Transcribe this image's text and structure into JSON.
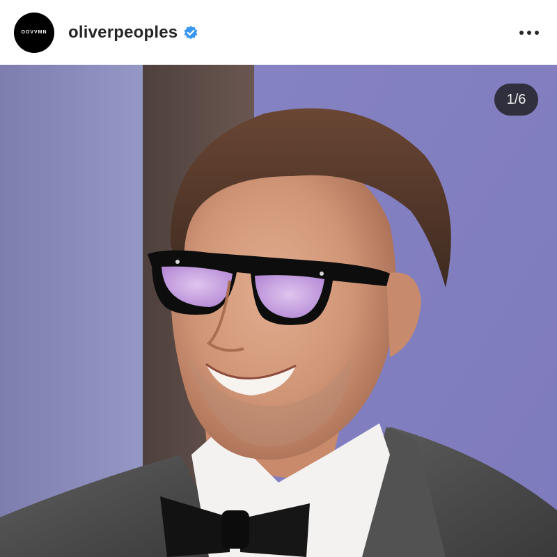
{
  "post": {
    "avatar_label": "OOVVMN",
    "username": "oliverpeoples",
    "verified": true,
    "counter": "1/6"
  },
  "icons": {
    "verified": "verified-badge-icon",
    "more": "more-horizontal-icon"
  },
  "colors": {
    "verified_blue": "#3897f0",
    "backdrop_lavender": "#8f8cc8",
    "lens_tint": "#c9a6e6"
  }
}
